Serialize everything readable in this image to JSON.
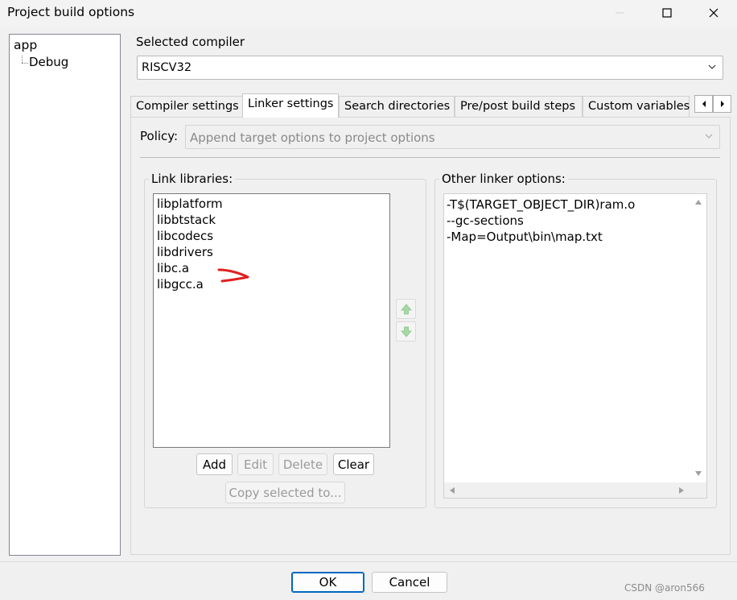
{
  "window": {
    "title": "Project build options",
    "minimize_icon": "minimize-icon",
    "maximize_icon": "maximize-icon",
    "close_icon": "close-icon"
  },
  "tree": {
    "root": "app",
    "children": [
      "Debug"
    ]
  },
  "compiler": {
    "label": "Selected compiler",
    "value": "RISCV32"
  },
  "tabs": [
    {
      "label": "Compiler settings",
      "active": false
    },
    {
      "label": "Linker settings",
      "active": true
    },
    {
      "label": "Search directories",
      "active": false
    },
    {
      "label": "Pre/post build steps",
      "active": false
    },
    {
      "label": "Custom variables",
      "active": false
    }
  ],
  "policy": {
    "label": "Policy:",
    "value": "Append target options to project options"
  },
  "link_libraries": {
    "title": "Link libraries:",
    "items": [
      "libplatform",
      "libbtstack",
      "libcodecs",
      "libdrivers",
      "libc.a",
      "libgcc.a"
    ],
    "add_label": "Add",
    "edit_label": "Edit",
    "delete_label": "Delete",
    "clear_label": "Clear",
    "copy_label": "Copy selected to..."
  },
  "other_linker": {
    "title": "Other linker options:",
    "lines": [
      "-T$(TARGET_OBJECT_DIR)ram.o",
      "--gc-sections",
      "-Map=Output\\bin\\map.txt"
    ]
  },
  "footer": {
    "ok_label": "OK",
    "cancel_label": "Cancel"
  },
  "watermark": "CSDN @aron566",
  "colors": {
    "accent": "#0067c0",
    "annotation": "#e02020",
    "arrow_green": "#5cb85c"
  }
}
